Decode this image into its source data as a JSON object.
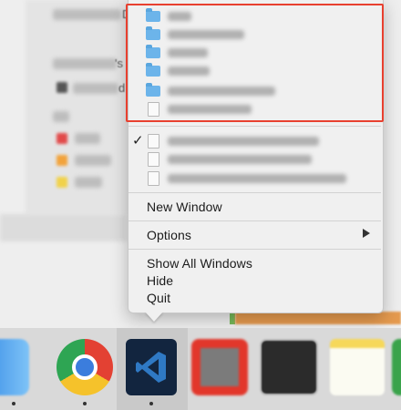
{
  "menu": {
    "items": {
      "new_window": "New Window",
      "options": "Options",
      "show_all_windows": "Show All Windows",
      "hide": "Hide",
      "quit": "Quit"
    },
    "check_glyph": "✓",
    "recent_folders_count": 5,
    "recent_files_count": 1,
    "open_windows_count": 3
  },
  "background": {
    "sidebar_letters": [
      "D",
      "'s",
      "d"
    ]
  },
  "dock": {
    "apps": [
      {
        "name": "finder",
        "icon": "finder-icon",
        "running": true
      },
      {
        "name": "chrome",
        "icon": "chrome-icon",
        "running": true
      },
      {
        "name": "vscode",
        "icon": "vscode-icon",
        "running": true,
        "active": true
      },
      {
        "name": "app-red",
        "icon": "red-app-icon",
        "running": false
      },
      {
        "name": "terminal",
        "icon": "terminal-icon",
        "running": false
      },
      {
        "name": "notes",
        "icon": "notes-icon",
        "running": false
      }
    ]
  },
  "colors": {
    "highlight_border": "#e8402f",
    "folder": "#6cb4ea",
    "menu_bg": "#f0f0f0"
  }
}
